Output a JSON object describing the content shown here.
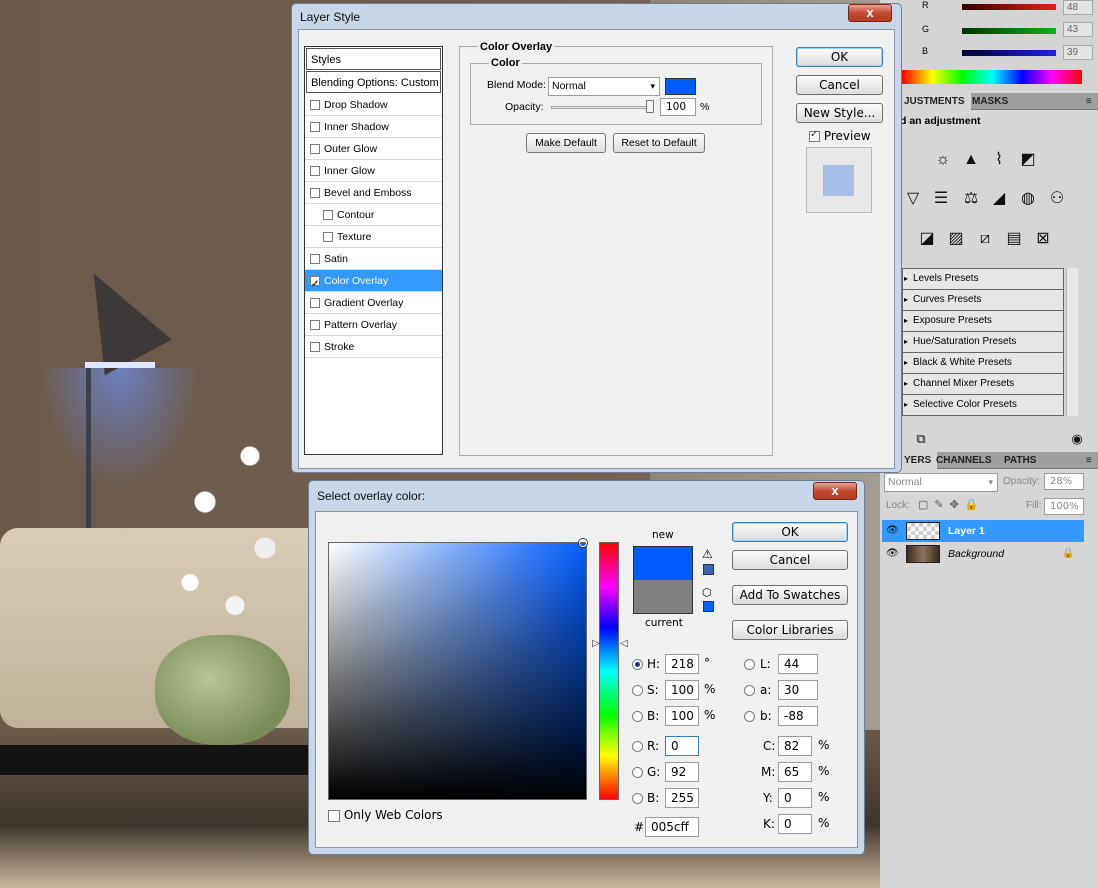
{
  "layer_style": {
    "title": "Layer Style",
    "close": "x",
    "styles_header": "Styles",
    "blending_options": "Blending Options: Custom",
    "effects": [
      {
        "label": "Drop Shadow",
        "checked": false,
        "sub": false
      },
      {
        "label": "Inner Shadow",
        "checked": false,
        "sub": false
      },
      {
        "label": "Outer Glow",
        "checked": false,
        "sub": false
      },
      {
        "label": "Inner Glow",
        "checked": false,
        "sub": false
      },
      {
        "label": "Bevel and Emboss",
        "checked": false,
        "sub": false
      },
      {
        "label": "Contour",
        "checked": false,
        "sub": true
      },
      {
        "label": "Texture",
        "checked": false,
        "sub": true
      },
      {
        "label": "Satin",
        "checked": false,
        "sub": false
      },
      {
        "label": "Color Overlay",
        "checked": true,
        "sub": false,
        "selected": true
      },
      {
        "label": "Gradient Overlay",
        "checked": false,
        "sub": false
      },
      {
        "label": "Pattern Overlay",
        "checked": false,
        "sub": false
      },
      {
        "label": "Stroke",
        "checked": false,
        "sub": false
      }
    ],
    "panel_title": "Color Overlay",
    "group_title": "Color",
    "blend_mode_label": "Blend Mode:",
    "blend_mode_value": "Normal",
    "overlay_color": "#005cff",
    "opacity_label": "Opacity:",
    "opacity_value": "100",
    "opacity_unit": "%",
    "make_default": "Make Default",
    "reset_default": "Reset to Default",
    "ok": "OK",
    "cancel": "Cancel",
    "new_style": "New Style...",
    "preview_label": "Preview",
    "preview_checked": true
  },
  "ps_panels": {
    "rgb": [
      {
        "label": "R",
        "value": "48",
        "color": "#e02020"
      },
      {
        "label": "G",
        "value": "43",
        "color": "#10b020"
      },
      {
        "label": "B",
        "value": "39",
        "color": "#2020e0"
      }
    ],
    "adj_tabs": [
      "JUSTMENTS",
      "MASKS"
    ],
    "adj_hint": "d an adjustment",
    "presets": [
      "Levels Presets",
      "Curves Presets",
      "Exposure Presets",
      "Hue/Saturation Presets",
      "Black & White Presets",
      "Channel Mixer Presets",
      "Selective Color Presets"
    ],
    "layer_tabs": [
      "YERS",
      "CHANNELS",
      "PATHS"
    ],
    "layer_blend": "Normal",
    "layer_opacity_label": "Opacity:",
    "layer_opacity": "28%",
    "lock_label": "Lock:",
    "fill_label": "Fill:",
    "fill_value": "100%",
    "layers": [
      {
        "name": "Layer 1",
        "selected": true
      },
      {
        "name": "Background",
        "selected": false
      }
    ]
  },
  "color_picker": {
    "title": "Select overlay color:",
    "close": "x",
    "new_label": "new",
    "current_label": "current",
    "ok": "OK",
    "cancel": "Cancel",
    "add_swatches": "Add To Swatches",
    "color_libraries": "Color Libraries",
    "only_web": "Only Web Colors",
    "new_color": "#005cff",
    "current_color": "#808080",
    "h": "218",
    "h_unit": "°",
    "s": "100",
    "s_unit": "%",
    "b": "100",
    "b_unit": "%",
    "r": "0",
    "g": "92",
    "b2": "255",
    "L": "44",
    "a": "30",
    "lab_b": "-88",
    "C": "82",
    "M": "65",
    "Y": "0",
    "K": "0",
    "hex": "005cff",
    "labels": {
      "H": "H:",
      "S": "S:",
      "B": "B:",
      "R": "R:",
      "G": "G:",
      "B2": "B:",
      "L": "L:",
      "a": "a:",
      "lab_b": "b:",
      "C": "C:",
      "M": "M:",
      "Y": "Y:",
      "K": "K:",
      "hash": "#"
    },
    "pct": "%"
  }
}
